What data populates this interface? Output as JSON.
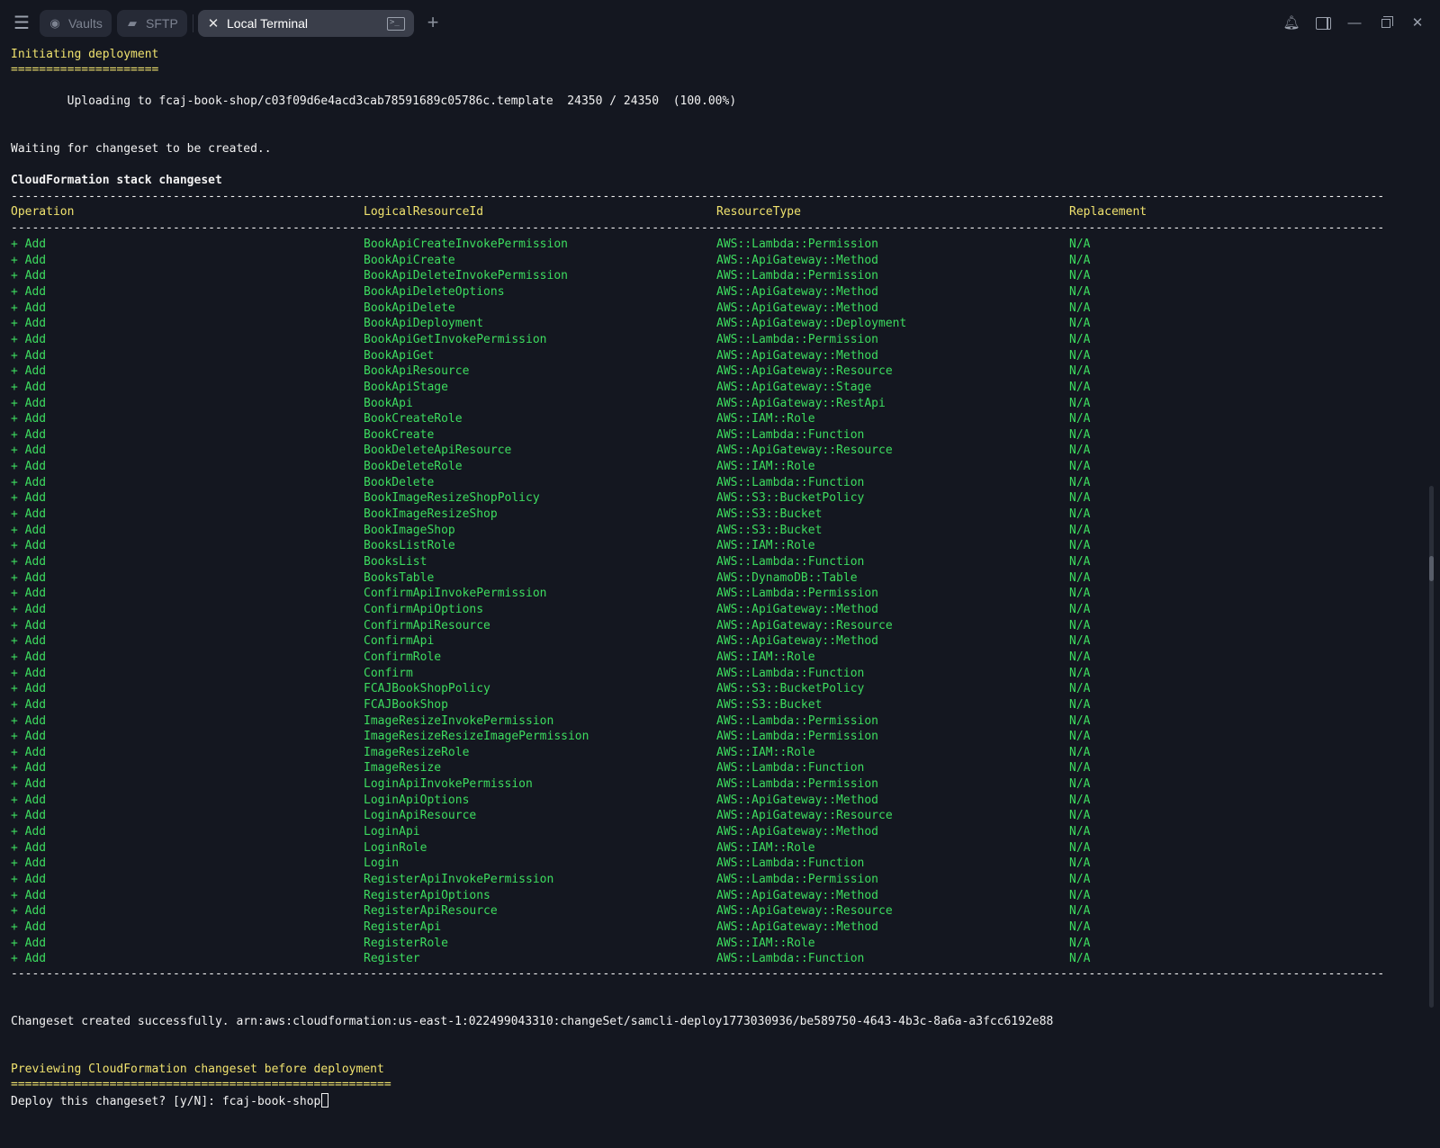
{
  "tabs": [
    {
      "label": "Vaults",
      "icon": "vault-icon"
    },
    {
      "label": "SFTP",
      "icon": "folder-icon"
    },
    {
      "label": "Local Terminal",
      "icon": "close-icon"
    }
  ],
  "terminal": {
    "section_init": "Initiating deployment",
    "underline_init": "=====================",
    "upload_line": "        Uploading to fcaj-book-shop/c03f09d6e4acd3cab78591689c05786c.template  24350 / 24350  (100.00%)",
    "waiting_line": "Waiting for changeset to be created..",
    "changeset_title": "CloudFormation stack changeset",
    "dash_line": "---------------------------------------------------------------------------------------------------------------------------------------------------------------------------------------------------",
    "headers": [
      "Operation",
      "LogicalResourceId",
      "ResourceType",
      "Replacement"
    ],
    "rows": [
      [
        "+ Add",
        "BookApiCreateInvokePermission",
        "AWS::Lambda::Permission",
        "N/A"
      ],
      [
        "+ Add",
        "BookApiCreate",
        "AWS::ApiGateway::Method",
        "N/A"
      ],
      [
        "+ Add",
        "BookApiDeleteInvokePermission",
        "AWS::Lambda::Permission",
        "N/A"
      ],
      [
        "+ Add",
        "BookApiDeleteOptions",
        "AWS::ApiGateway::Method",
        "N/A"
      ],
      [
        "+ Add",
        "BookApiDelete",
        "AWS::ApiGateway::Method",
        "N/A"
      ],
      [
        "+ Add",
        "BookApiDeployment",
        "AWS::ApiGateway::Deployment",
        "N/A"
      ],
      [
        "+ Add",
        "BookApiGetInvokePermission",
        "AWS::Lambda::Permission",
        "N/A"
      ],
      [
        "+ Add",
        "BookApiGet",
        "AWS::ApiGateway::Method",
        "N/A"
      ],
      [
        "+ Add",
        "BookApiResource",
        "AWS::ApiGateway::Resource",
        "N/A"
      ],
      [
        "+ Add",
        "BookApiStage",
        "AWS::ApiGateway::Stage",
        "N/A"
      ],
      [
        "+ Add",
        "BookApi",
        "AWS::ApiGateway::RestApi",
        "N/A"
      ],
      [
        "+ Add",
        "BookCreateRole",
        "AWS::IAM::Role",
        "N/A"
      ],
      [
        "+ Add",
        "BookCreate",
        "AWS::Lambda::Function",
        "N/A"
      ],
      [
        "+ Add",
        "BookDeleteApiResource",
        "AWS::ApiGateway::Resource",
        "N/A"
      ],
      [
        "+ Add",
        "BookDeleteRole",
        "AWS::IAM::Role",
        "N/A"
      ],
      [
        "+ Add",
        "BookDelete",
        "AWS::Lambda::Function",
        "N/A"
      ],
      [
        "+ Add",
        "BookImageResizeShopPolicy",
        "AWS::S3::BucketPolicy",
        "N/A"
      ],
      [
        "+ Add",
        "BookImageResizeShop",
        "AWS::S3::Bucket",
        "N/A"
      ],
      [
        "+ Add",
        "BookImageShop",
        "AWS::S3::Bucket",
        "N/A"
      ],
      [
        "+ Add",
        "BooksListRole",
        "AWS::IAM::Role",
        "N/A"
      ],
      [
        "+ Add",
        "BooksList",
        "AWS::Lambda::Function",
        "N/A"
      ],
      [
        "+ Add",
        "BooksTable",
        "AWS::DynamoDB::Table",
        "N/A"
      ],
      [
        "+ Add",
        "ConfirmApiInvokePermission",
        "AWS::Lambda::Permission",
        "N/A"
      ],
      [
        "+ Add",
        "ConfirmApiOptions",
        "AWS::ApiGateway::Method",
        "N/A"
      ],
      [
        "+ Add",
        "ConfirmApiResource",
        "AWS::ApiGateway::Resource",
        "N/A"
      ],
      [
        "+ Add",
        "ConfirmApi",
        "AWS::ApiGateway::Method",
        "N/A"
      ],
      [
        "+ Add",
        "ConfirmRole",
        "AWS::IAM::Role",
        "N/A"
      ],
      [
        "+ Add",
        "Confirm",
        "AWS::Lambda::Function",
        "N/A"
      ],
      [
        "+ Add",
        "FCAJBookShopPolicy",
        "AWS::S3::BucketPolicy",
        "N/A"
      ],
      [
        "+ Add",
        "FCAJBookShop",
        "AWS::S3::Bucket",
        "N/A"
      ],
      [
        "+ Add",
        "ImageResizeInvokePermission",
        "AWS::Lambda::Permission",
        "N/A"
      ],
      [
        "+ Add",
        "ImageResizeResizeImagePermission",
        "AWS::Lambda::Permission",
        "N/A"
      ],
      [
        "+ Add",
        "ImageResizeRole",
        "AWS::IAM::Role",
        "N/A"
      ],
      [
        "+ Add",
        "ImageResize",
        "AWS::Lambda::Function",
        "N/A"
      ],
      [
        "+ Add",
        "LoginApiInvokePermission",
        "AWS::Lambda::Permission",
        "N/A"
      ],
      [
        "+ Add",
        "LoginApiOptions",
        "AWS::ApiGateway::Method",
        "N/A"
      ],
      [
        "+ Add",
        "LoginApiResource",
        "AWS::ApiGateway::Resource",
        "N/A"
      ],
      [
        "+ Add",
        "LoginApi",
        "AWS::ApiGateway::Method",
        "N/A"
      ],
      [
        "+ Add",
        "LoginRole",
        "AWS::IAM::Role",
        "N/A"
      ],
      [
        "+ Add",
        "Login",
        "AWS::Lambda::Function",
        "N/A"
      ],
      [
        "+ Add",
        "RegisterApiInvokePermission",
        "AWS::Lambda::Permission",
        "N/A"
      ],
      [
        "+ Add",
        "RegisterApiOptions",
        "AWS::ApiGateway::Method",
        "N/A"
      ],
      [
        "+ Add",
        "RegisterApiResource",
        "AWS::ApiGateway::Resource",
        "N/A"
      ],
      [
        "+ Add",
        "RegisterApi",
        "AWS::ApiGateway::Method",
        "N/A"
      ],
      [
        "+ Add",
        "RegisterRole",
        "AWS::IAM::Role",
        "N/A"
      ],
      [
        "+ Add",
        "Register",
        "AWS::Lambda::Function",
        "N/A"
      ]
    ],
    "changeset_success": "Changeset created successfully. arn:aws:cloudformation:us-east-1:022499043310:changeSet/samcli-deploy1773030936/be589750-4643-4b3c-8a6a-a3fcc6192e88",
    "section_preview": "Previewing CloudFormation changeset before deployment",
    "underline_preview": "======================================================",
    "prompt": "Deploy this changeset? [y/N]: ",
    "input_value": "fcaj-book-shop"
  },
  "colors": {
    "background": "#141720",
    "yellow": "#f0e26e",
    "green": "#3ddc5f",
    "active_tab": "#3a3e4a"
  }
}
